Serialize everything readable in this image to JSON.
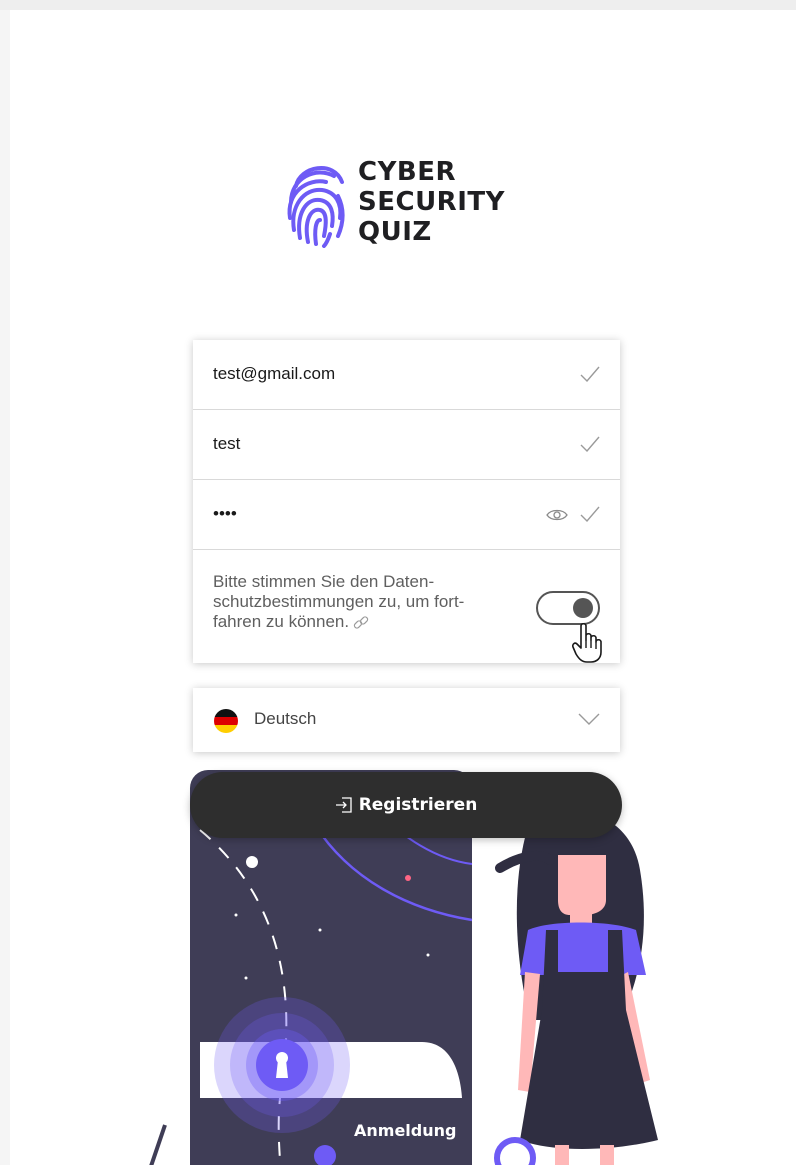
{
  "logo": {
    "icon": "fingerprint-icon",
    "line1": "CYBER",
    "line2": "SECURITY",
    "line3": "QUIZ",
    "color": "#6E5BF5"
  },
  "form": {
    "email_value": "test@gmail.com",
    "username_value": "test",
    "password_value": "••••",
    "consent_line1": "Bitte stimmen Sie den Daten-",
    "consent_line2": "schutzbestimmungen zu, um fort-",
    "consent_line3": "fahren zu können.",
    "consent_toggle": "on"
  },
  "language": {
    "selected": "Deutsch",
    "flag": "german-flag-icon"
  },
  "actions": {
    "register_label": "Registrieren",
    "login_label": "Anmeldung"
  },
  "colors": {
    "accent": "#6E5BF5",
    "dark": "#2E2E2E",
    "phone": "#3F3D56"
  }
}
